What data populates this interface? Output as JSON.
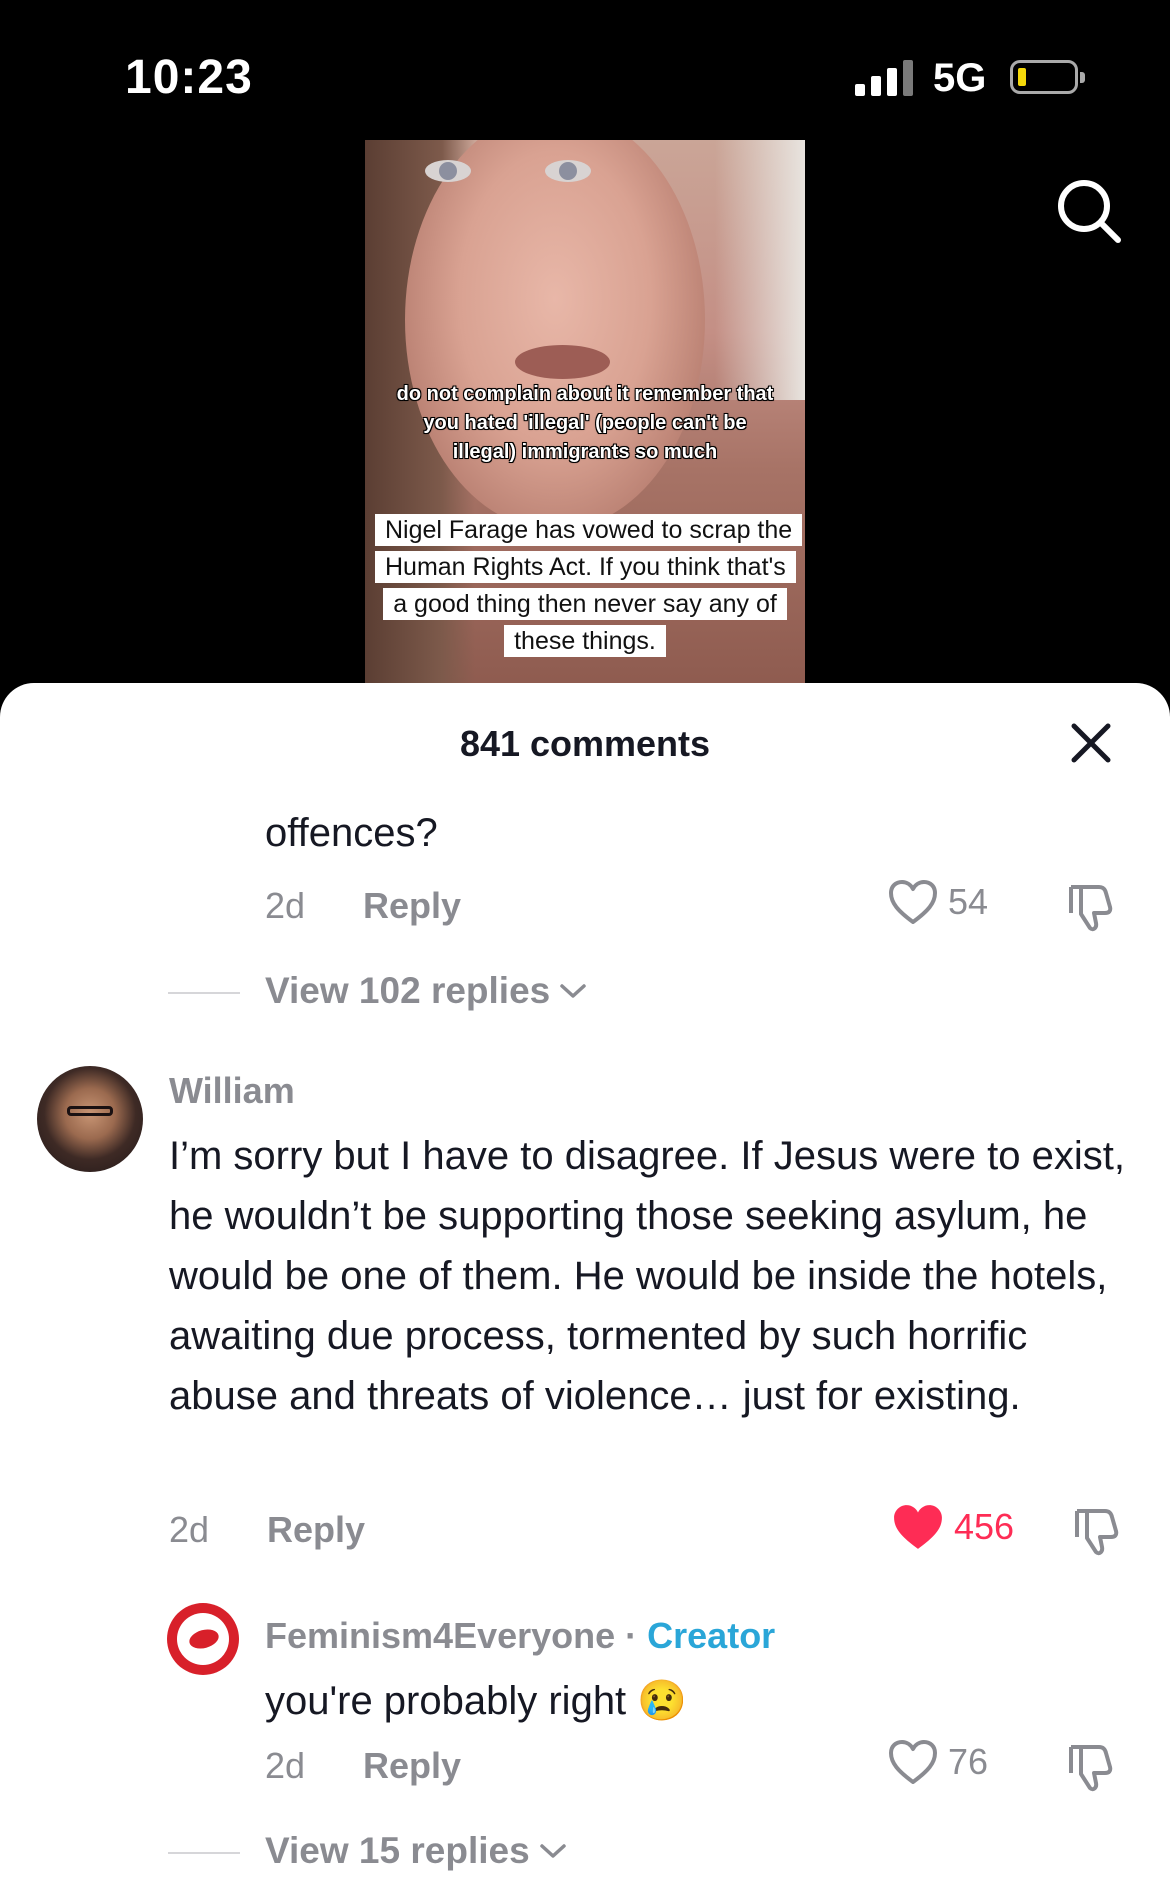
{
  "status_bar": {
    "time": "10:23",
    "network": "5G"
  },
  "video": {
    "caption_top": "do not complain about it remember that you hated 'illegal' (people can't be illegal) immigrants so much",
    "caption_box": "Nigel Farage has vowed to scrap the Human Rights Act. If you think that's a good thing then never say any of these things."
  },
  "sheet": {
    "title": "841 comments",
    "comments": [
      {
        "text_tail": "offences?",
        "age": "2d",
        "reply_label": "Reply",
        "likes": "54",
        "liked": false,
        "view_replies": "View 102 replies"
      },
      {
        "username": "William",
        "text": "I’m sorry but I have to disagree. If Jesus were to exist, he wouldn’t be supporting those seeking asylum, he would be one of them. He would be inside the hotels, awaiting due process, tormented by such horrific abuse and threats of violence… just for existing.",
        "age": "2d",
        "reply_label": "Reply",
        "likes": "456",
        "liked": true,
        "replies": [
          {
            "username": "Feminism4Everyone",
            "separator": " · ",
            "badge": "Creator",
            "text": "you're probably right 😢",
            "age": "2d",
            "reply_label": "Reply",
            "likes": "76",
            "liked": false
          }
        ],
        "view_replies": "View 15 replies"
      }
    ]
  },
  "colors": {
    "like_active": "#fe2c55",
    "creator_badge": "#2aa6d8",
    "muted": "#8a8b91"
  }
}
